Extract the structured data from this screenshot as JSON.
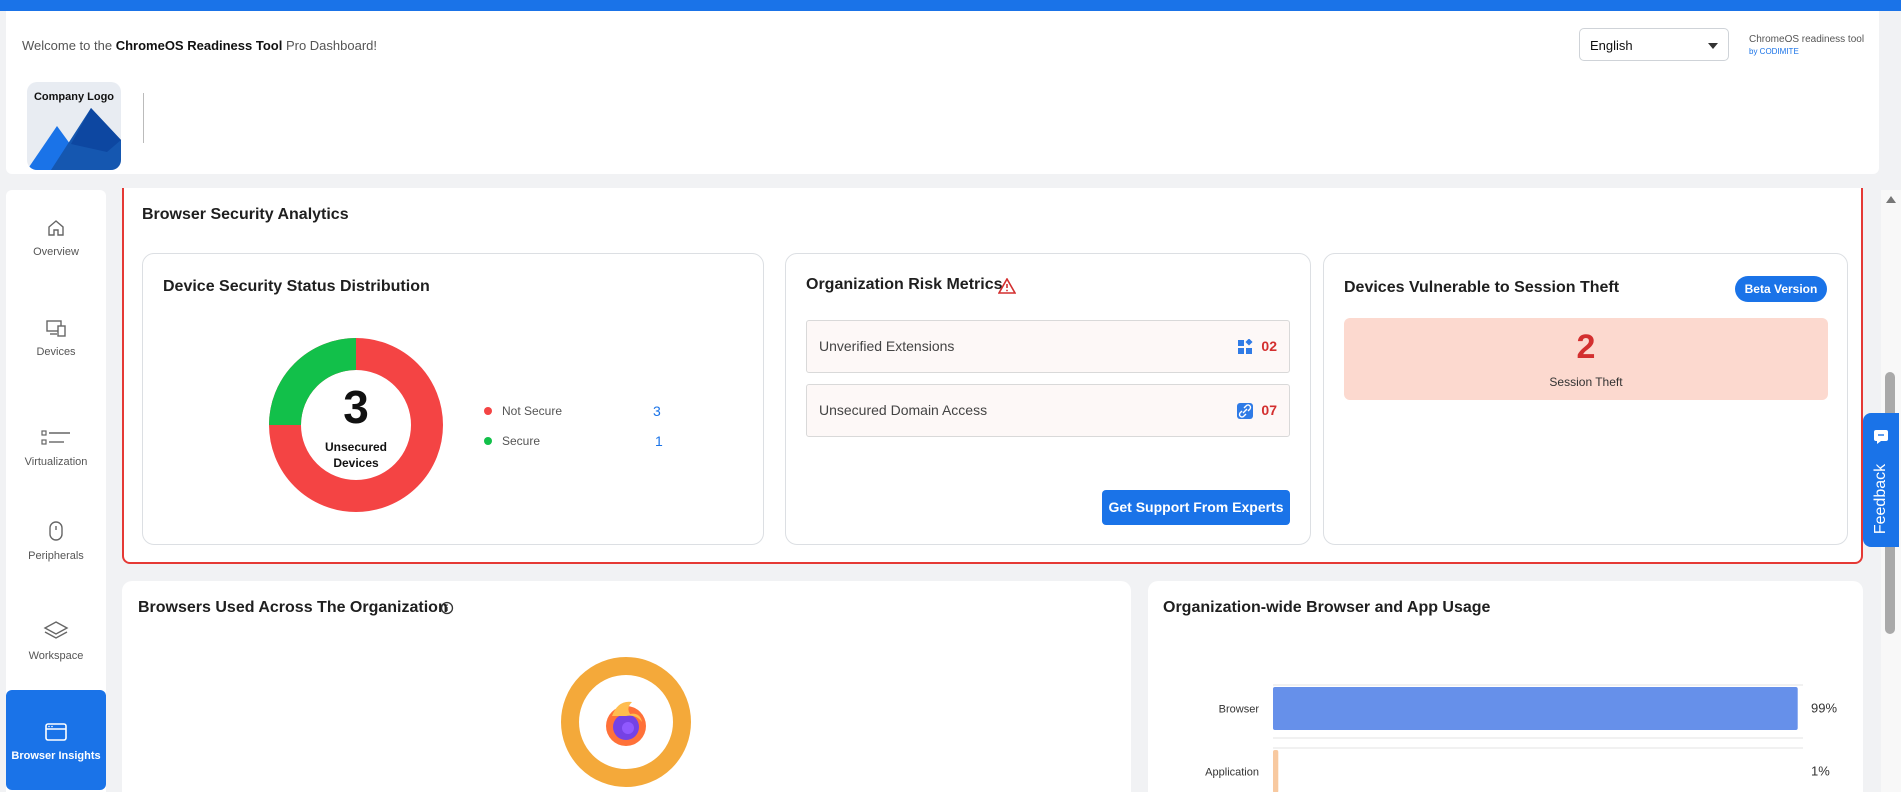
{
  "header": {
    "welcome_prefix": "Welcome to the ",
    "welcome_bold": "ChromeOS Readiness Tool",
    "welcome_suffix": " Pro Dashboard!",
    "logo_text": "Company Logo",
    "language": "English",
    "brand_line1": "ChromeOS readiness tool",
    "brand_line2": "by CODIMITE"
  },
  "sidebar": {
    "items": [
      {
        "label": "Overview",
        "icon": "home-icon"
      },
      {
        "label": "Devices",
        "icon": "devices-icon"
      },
      {
        "label": "Virtualization",
        "icon": "list-icon"
      },
      {
        "label": "Peripherals",
        "icon": "mouse-icon"
      },
      {
        "label": "Workspace",
        "icon": "layers-icon"
      },
      {
        "label": "Browser Insights",
        "icon": "browser-icon",
        "active": true
      }
    ]
  },
  "browser_security": {
    "title": "Browser Security Analytics",
    "distribution": {
      "title": "Device Security Status Distribution",
      "center_value": "3",
      "center_label_1": "Unsecured",
      "center_label_2": "Devices",
      "legend": [
        {
          "label": "Not Secure",
          "value": "3",
          "color": "#f44444"
        },
        {
          "label": "Secure",
          "value": "1",
          "color": "#12c04a"
        }
      ]
    },
    "risk": {
      "title": "Organization Risk Metrics",
      "rows": [
        {
          "label": "Unverified Extensions",
          "value": "02",
          "icon": "extensions-icon"
        },
        {
          "label": "Unsecured Domain Access",
          "value": "07",
          "icon": "link-icon"
        }
      ],
      "button": "Get Support From Experts"
    },
    "session_theft": {
      "title": "Devices Vulnerable to Session Theft",
      "badge": "Beta Version",
      "value": "2",
      "label": "Session Theft"
    }
  },
  "browsers_used": {
    "title": "Browsers Used Across The Organization",
    "browser_icon": "firefox-icon",
    "ring_color": "#f4a93a"
  },
  "usage": {
    "title": "Organization-wide Browser and App Usage",
    "chart_data": {
      "type": "bar",
      "orientation": "horizontal",
      "categories": [
        "Browser",
        "Application"
      ],
      "values": [
        99,
        1
      ],
      "value_labels": [
        "99%",
        "1%"
      ],
      "colors": [
        "#6690ea",
        "#f8c9a0"
      ],
      "xlim": [
        0,
        100
      ]
    }
  },
  "feedback": {
    "label": "Feedback"
  }
}
